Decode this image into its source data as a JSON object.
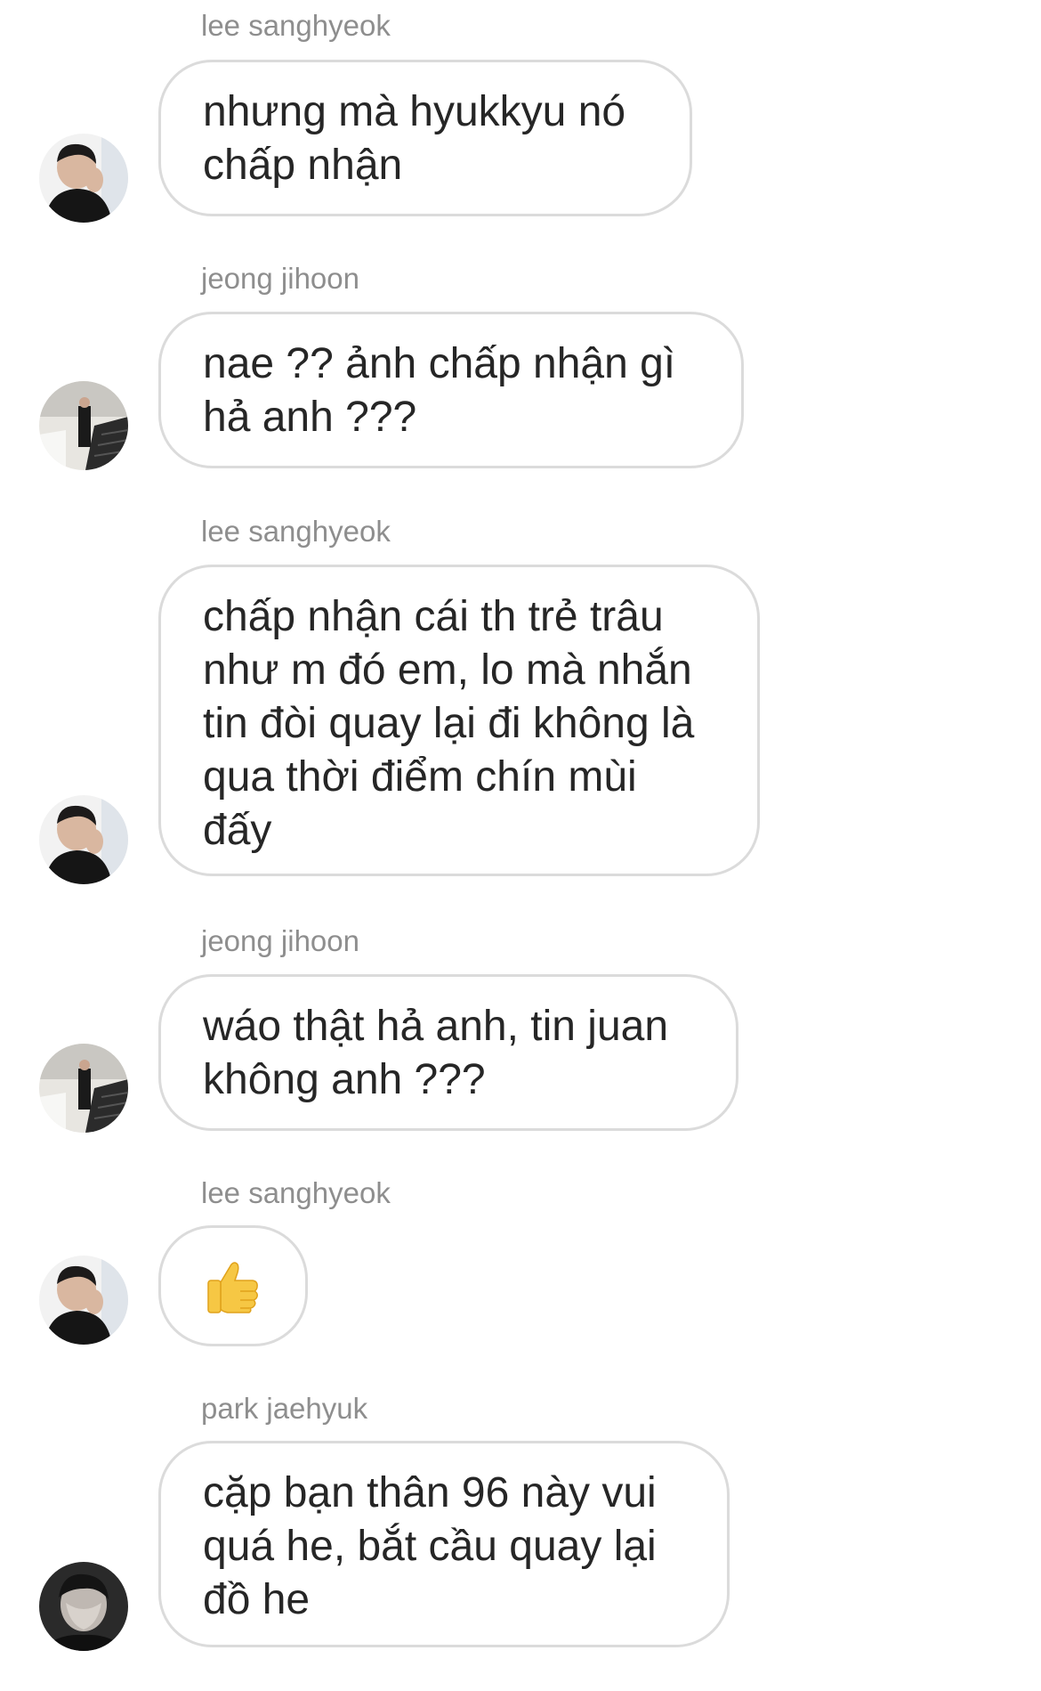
{
  "messages": [
    {
      "sender": "lee sanghyeok",
      "text": "nhưng mà hyukkyu nó\nchấp nhận",
      "avatar_icon": "user-avatar-icon"
    },
    {
      "sender": "jeong jihoon",
      "text": "nae ?? ảnh chấp nhận gì\nhả anh ???",
      "avatar_icon": "user-avatar-icon"
    },
    {
      "sender": "lee sanghyeok",
      "text": "chấp nhận cái th trẻ trâu\nnhư m đó em, lo mà nhắn\ntin đòi quay lại đi không là\nqua thời điểm chín mùi\nđấy",
      "avatar_icon": "user-avatar-icon"
    },
    {
      "sender": "jeong jihoon",
      "text": "wáo thật hả anh, tin juan\nkhông anh ???",
      "avatar_icon": "user-avatar-icon"
    },
    {
      "sender": "lee sanghyeok",
      "text": "",
      "reaction_icon": "thumbs-up-icon",
      "avatar_icon": "user-avatar-icon"
    },
    {
      "sender": "park jaehyuk",
      "text": "cặp bạn thân 96 này vui\nquá he, bắt cầu quay lại\nđồ he",
      "avatar_icon": "user-avatar-icon"
    }
  ],
  "colors": {
    "sender_name": "#8e8e8e",
    "message_text": "#262626",
    "bubble_border": "#dbdbdb",
    "background": "#ffffff"
  }
}
